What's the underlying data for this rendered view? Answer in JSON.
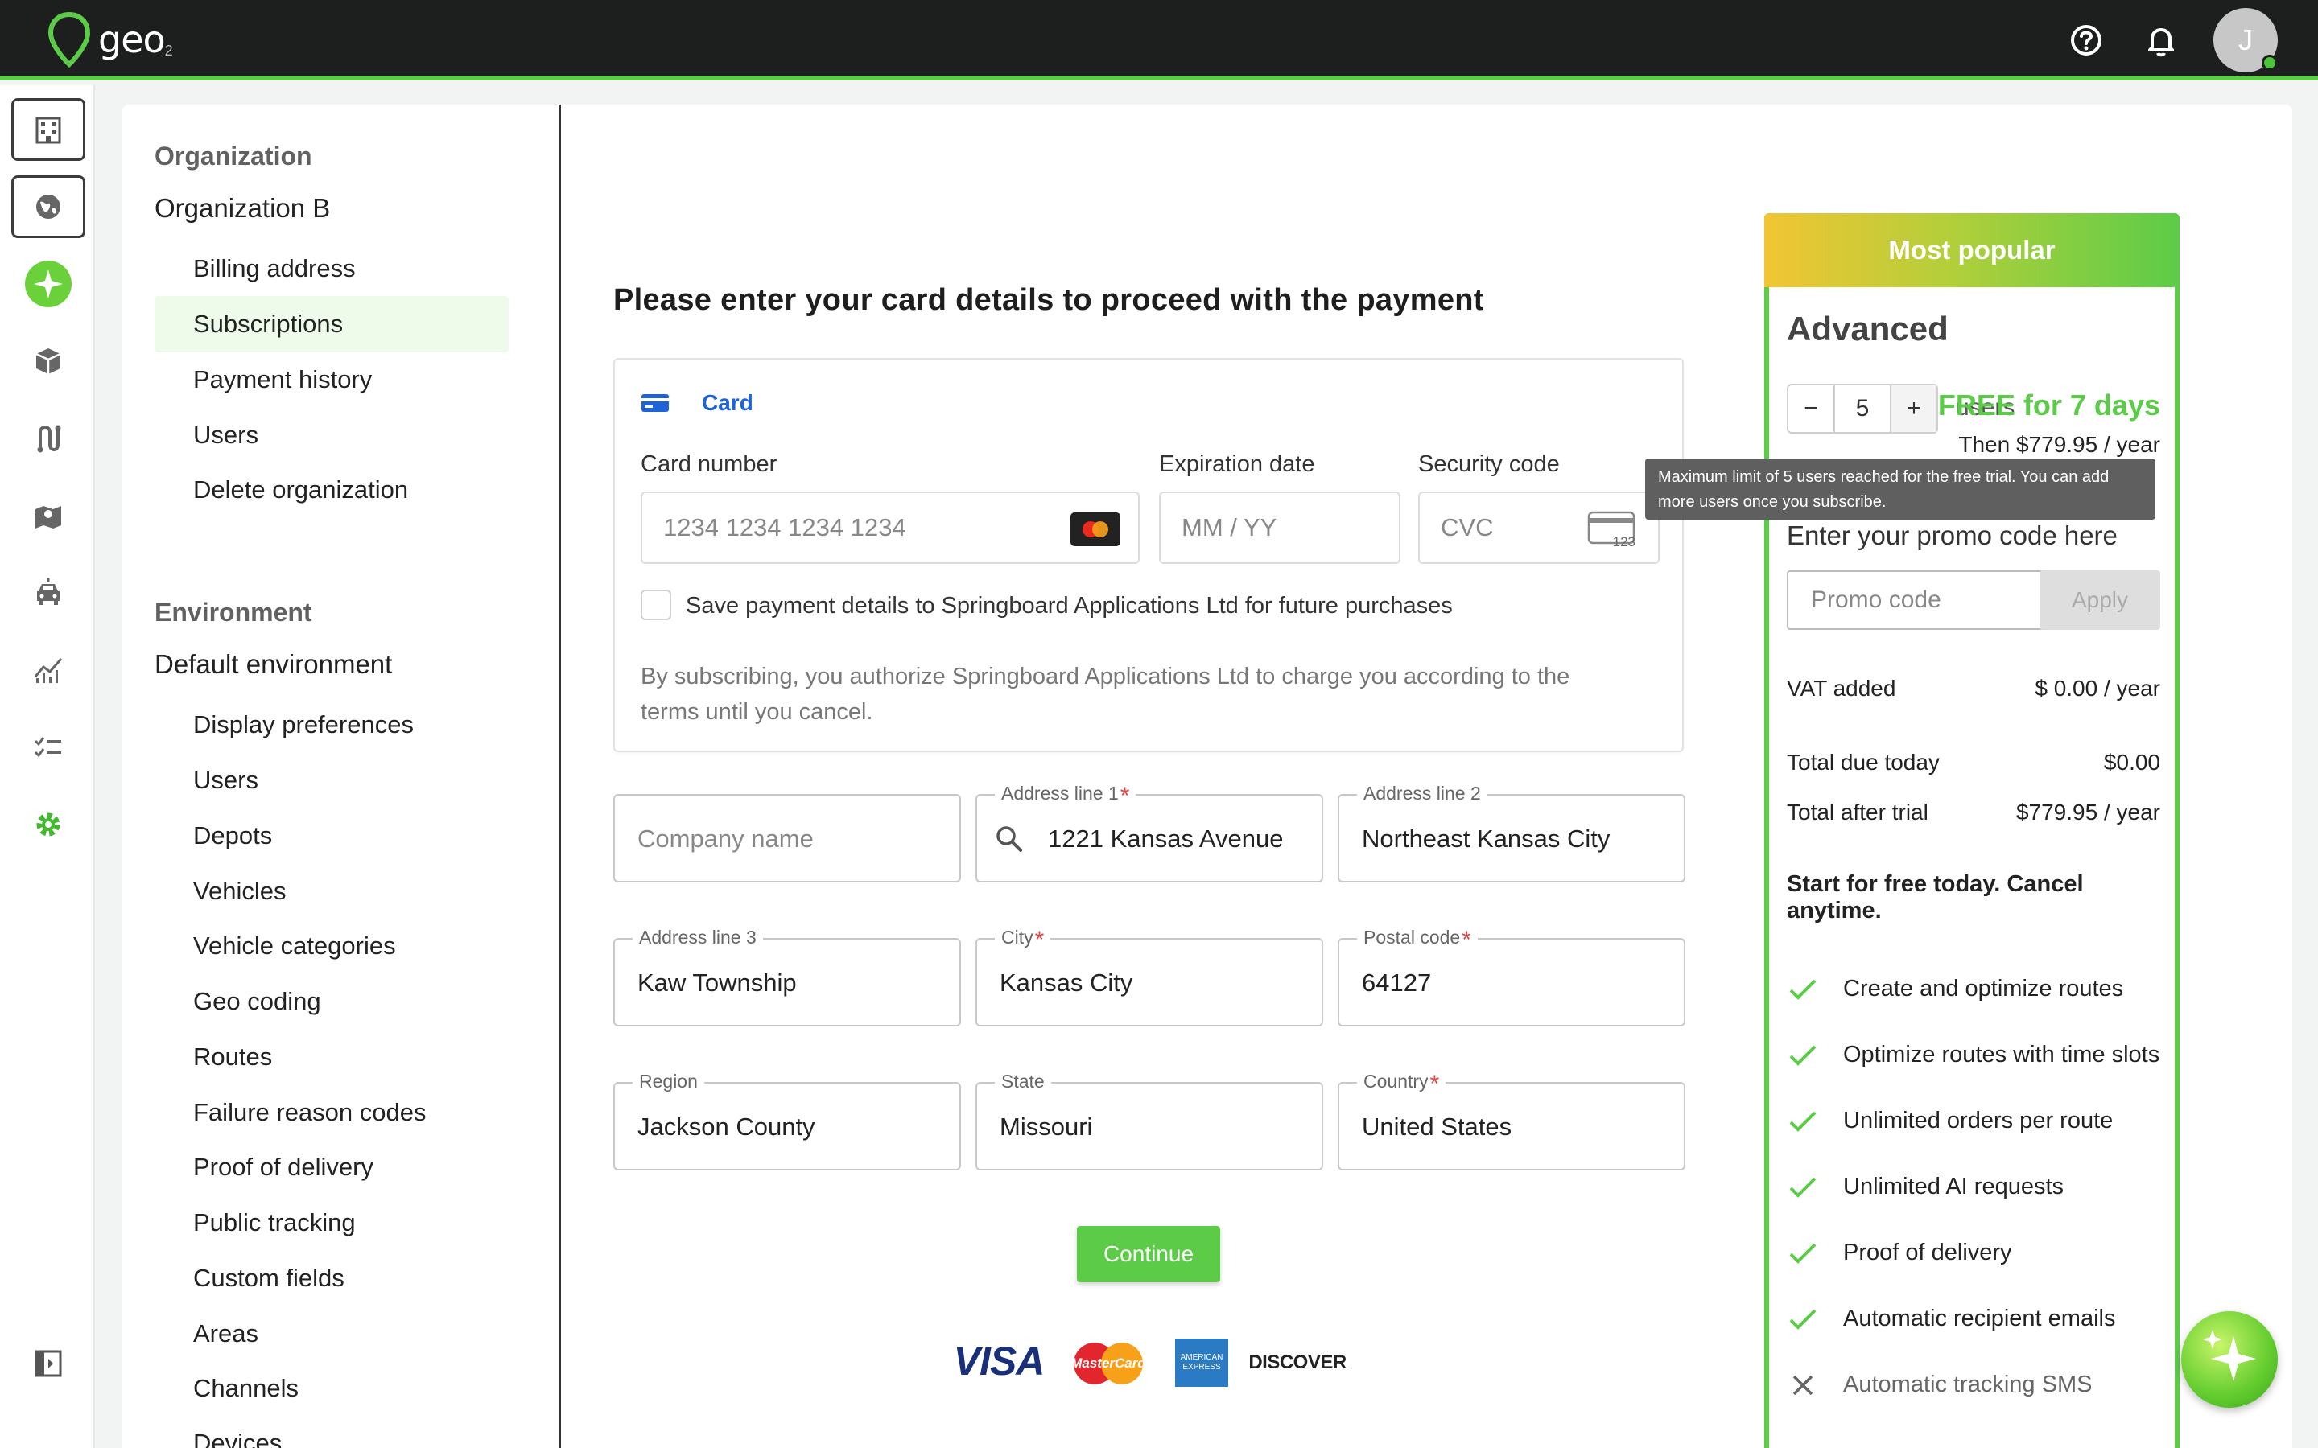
{
  "app": {
    "logo_text": "geo",
    "logo_sub": "2",
    "avatar_initial": "J"
  },
  "colors": {
    "brand_green": "#5ccc48",
    "topbar": "#1d1e1e",
    "card_blue": "#1f63d8",
    "required_red": "#e04848"
  },
  "topbar": {
    "icons": [
      "help-icon",
      "bell-icon"
    ]
  },
  "rail": {
    "icons": [
      "building-icon",
      "globe-icon",
      "ai-sparkle-icon",
      "package-icon",
      "route-icon",
      "map-icon",
      "vehicle-icon",
      "analytics-icon",
      "checklist-icon",
      "settings-icon",
      "collapse-sidebar-icon"
    ]
  },
  "nav": {
    "org_heading": "Organization",
    "org_name": "Organization B",
    "org_items": [
      "Billing address",
      "Subscriptions",
      "Payment history",
      "Users",
      "Delete organization"
    ],
    "env_heading": "Environment",
    "env_name": "Default environment",
    "env_items": [
      "Display preferences",
      "Users",
      "Depots",
      "Vehicles",
      "Vehicle categories",
      "Geo coding",
      "Routes",
      "Failure reason codes",
      "Proof of delivery",
      "Public tracking",
      "Custom fields",
      "Areas",
      "Channels",
      "Devices"
    ]
  },
  "payment": {
    "heading": "Please enter your card details to proceed with the payment",
    "tab_label": "Card",
    "card_number_label": "Card number",
    "card_number_placeholder": "1234 1234 1234 1234",
    "expiry_label": "Expiration date",
    "expiry_placeholder": "MM / YY",
    "cvc_label": "Security code",
    "cvc_placeholder": "CVC",
    "cvc_badge": "123",
    "save_text": "Save payment details to Springboard Applications Ltd for future purchases",
    "legal": "By subscribing, you authorize Springboard Applications Ltd to charge you according to the terms until you cancel."
  },
  "address": {
    "company": {
      "label": "",
      "placeholder": "Company name",
      "value": ""
    },
    "line1": {
      "label": "Address line 1",
      "value": "1221 Kansas Avenue"
    },
    "line2": {
      "label": "Address line 2",
      "value": "Northeast Kansas City"
    },
    "line3": {
      "label": "Address line 3",
      "value": "Kaw Township"
    },
    "city": {
      "label": "City",
      "value": "Kansas City"
    },
    "postal": {
      "label": "Postal code",
      "value": "64127"
    },
    "region": {
      "label": "Region",
      "value": "Jackson County"
    },
    "state": {
      "label": "State",
      "value": "Missouri"
    },
    "country": {
      "label": "Country",
      "value": "United States"
    },
    "required_mark": "*"
  },
  "continue_label": "Continue",
  "payment_logos": [
    "VISA",
    "MasterCard",
    "AMERICAN EXPRESS",
    "DISCOVER"
  ],
  "plan": {
    "banner": "Most popular",
    "name": "Advanced",
    "minus": "−",
    "plus": "+",
    "users_count": "5",
    "users_label": "users",
    "free_label": "FREE for 7 days",
    "then_label": "Then $779.95 / year",
    "tooltip": "Maximum limit of 5 users reached for the free trial. You can add more users once you subscribe.",
    "promo_title": "Enter your promo code here",
    "promo_placeholder": "Promo code",
    "apply_label": "Apply",
    "vat_label": "VAT added",
    "vat_value": "$ 0.00 / year",
    "due_label": "Total due today",
    "due_value": "$0.00",
    "after_label": "Total after trial",
    "after_value": "$779.95 / year",
    "start_text": "Start for free today. Cancel anytime.",
    "features": [
      {
        "label": "Create and optimize routes",
        "included": true
      },
      {
        "label": "Optimize routes with time slots",
        "included": true
      },
      {
        "label": "Unlimited orders per route",
        "included": true
      },
      {
        "label": "Unlimited AI requests",
        "included": true
      },
      {
        "label": "Proof of delivery",
        "included": true
      },
      {
        "label": "Automatic recipient emails",
        "included": true
      },
      {
        "label": "Automatic tracking SMS",
        "included": false
      }
    ]
  }
}
